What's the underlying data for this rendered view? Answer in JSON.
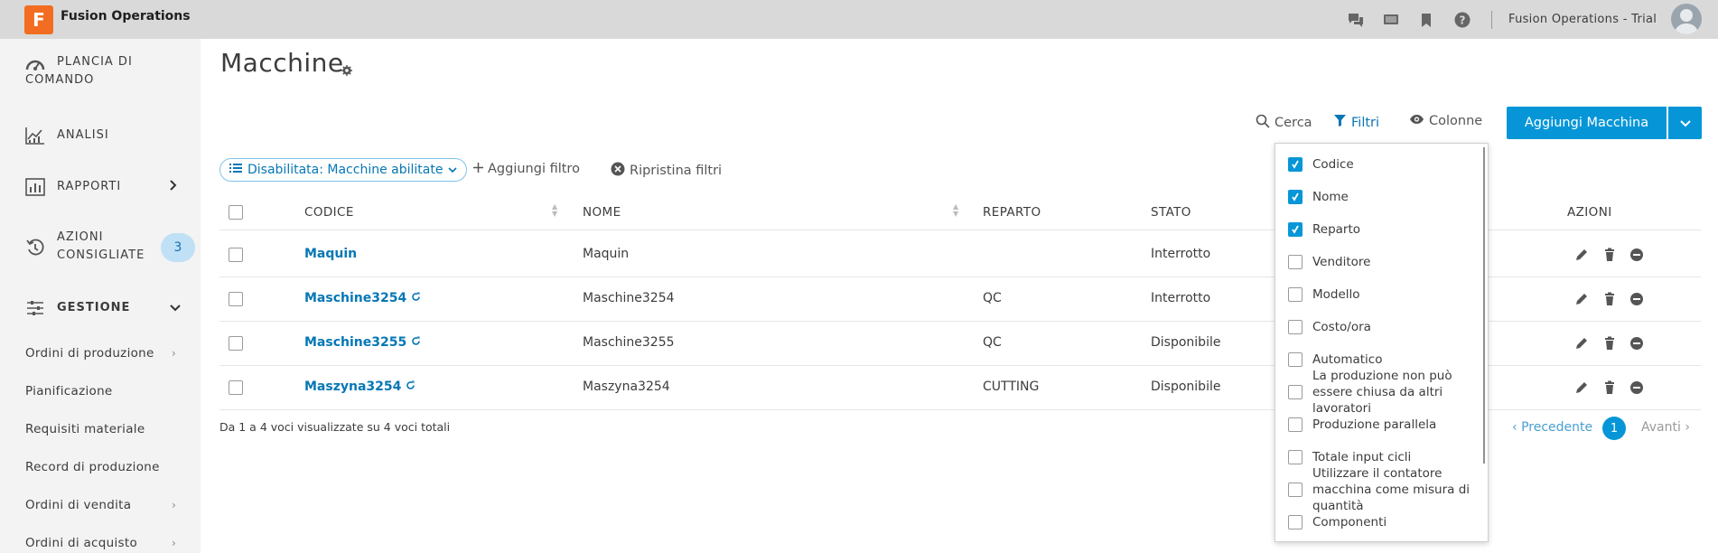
{
  "topbar": {
    "logo_letter": "F",
    "app_title": "Fusion Operations",
    "user_label": "Fusion Operations - Trial",
    "icons": [
      "chat-icon",
      "monitor-icon",
      "bookmark-icon",
      "help-icon"
    ]
  },
  "sidebar": {
    "items": [
      {
        "label_line1": "PLANCIA DI",
        "label_line2": "COMANDO",
        "icon": "dashboard-icon"
      },
      {
        "label": "ANALISI",
        "icon": "analytics-icon"
      },
      {
        "label": "RAPPORTI",
        "icon": "reports-icon"
      },
      {
        "label_line1": "AZIONI",
        "label_line2": "CONSIGLIATE",
        "icon": "history-icon",
        "badge": "3"
      },
      {
        "label": "GESTIONE",
        "icon": "sliders-icon"
      }
    ],
    "sub_items": [
      {
        "label": "Ordini di produzione",
        "has_arrow": true
      },
      {
        "label": "Pianificazione",
        "has_arrow": false
      },
      {
        "label": "Requisiti materiale",
        "has_arrow": false
      },
      {
        "label": "Record di produzione",
        "has_arrow": false
      },
      {
        "label": "Ordini di vendita",
        "has_arrow": true
      },
      {
        "label": "Ordini di acquisto",
        "has_arrow": true
      }
    ]
  },
  "main": {
    "title": "Macchine",
    "toolbar": {
      "search": "Cerca",
      "filters": "Filtri",
      "columns": "Colonne",
      "add_button": "Aggiungi Macchina"
    },
    "filter_chip": "Disabilitata: Macchine abilitate",
    "add_filter": "Aggiungi filtro",
    "reset_filters": "Ripristina filtri",
    "table": {
      "headers": {
        "code": "CODICE",
        "name": "NOME",
        "department": "REPARTO",
        "status": "STATO",
        "actions": "AZIONI"
      },
      "rows": [
        {
          "code": "Maquin",
          "synced": false,
          "name": "Maquin",
          "department": "",
          "status": "Interrotto"
        },
        {
          "code": "Maschine3254",
          "synced": true,
          "name": "Maschine3254",
          "department": "QC",
          "status": "Interrotto"
        },
        {
          "code": "Maschine3255",
          "synced": true,
          "name": "Maschine3255",
          "department": "QC",
          "status": "Disponibile"
        },
        {
          "code": "Maszyna3254",
          "synced": true,
          "name": "Maszyna3254",
          "department": "CUTTING",
          "status": "Disponibile"
        }
      ]
    },
    "footer": {
      "info": "Da 1 a 4 voci visualizzate su 4 voci totali",
      "prev": "Precedente",
      "page": "1",
      "next": "Avanti"
    }
  },
  "columns_popup": {
    "options": [
      {
        "label": "Codice",
        "checked": true
      },
      {
        "label": "Nome",
        "checked": true
      },
      {
        "label": "Reparto",
        "checked": true
      },
      {
        "label": "Venditore",
        "checked": false
      },
      {
        "label": "Modello",
        "checked": false
      },
      {
        "label": "Costo/ora",
        "checked": false
      },
      {
        "label": "Automatico",
        "checked": false
      },
      {
        "label": "La produzione non può essere chiusa da altri lavoratori",
        "checked": false
      },
      {
        "label": "Produzione parallela",
        "checked": false
      },
      {
        "label": "Totale input cicli",
        "checked": false
      },
      {
        "label": "Utilizzare il contatore macchina come misura di quantità",
        "checked": false
      },
      {
        "label": "Componenti",
        "checked": false
      }
    ]
  },
  "colors": {
    "accent": "#0696d7",
    "link": "#0677b5",
    "brand_orange": "#f26d21",
    "topbar_bg": "#d9d9d9",
    "sidebar_bg": "#f3f3f3",
    "badge_bg": "#bfe0f5"
  }
}
